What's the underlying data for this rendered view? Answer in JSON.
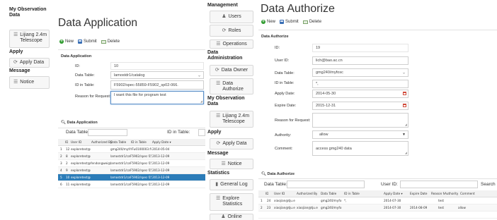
{
  "left": {
    "sidebar": {
      "section_my_obs": "My Observation Data",
      "telescope": "Lijiang 2.4m Telescope",
      "section_apply": "Apply",
      "apply_data": "Apply Data",
      "section_message": "Message",
      "notice": "Notice"
    },
    "title": "Data Application",
    "toolbar": {
      "new": "New",
      "submit": "Submit",
      "delete": "Delete"
    },
    "form": {
      "panel_title": "Data Application",
      "id_label": "ID:",
      "id_value": "10",
      "table_label": "Data Table:",
      "table_value": "lamostdr1/catalog",
      "idtable_label": "ID in Table:",
      "idtable_value": "F5902/spec-55859-F5902_sp02-066.",
      "reason_label": "Reason for Request:",
      "reason_value": "I want this file for program test"
    },
    "grid": {
      "panel_title": "Data Application",
      "filter_table_label": "Data Table:",
      "filter_id_label": "ID in Table:",
      "columns": [
        "ID",
        "User ID",
        "Authorized By",
        "Data Table",
        "ID in Table",
        "Apply Date ▾"
      ],
      "rows": [
        [
          "1",
          "12",
          "exploretest@e",
          "",
          "gmg240/myfo",
          "YFu0100003.fit",
          "2014-05-04"
        ],
        [
          "2",
          "8",
          "exploretest@e",
          "",
          "lamostdr1/cat",
          "F5902/spec-55",
          "2013-12-09"
        ],
        [
          "3",
          "2",
          "exploretest@e",
          "fendongwei@t",
          "lamostdr1/cat",
          "F5902/spec-55",
          "2013-12-09"
        ],
        [
          "4",
          "9",
          "exploretest@e",
          "",
          "lamostdr1/cat",
          "F5902/spec-55",
          "2013-12-09"
        ],
        [
          "5",
          "10",
          "exploretest@e",
          "",
          "lamostdr1/cat",
          "F5902/spec-55",
          "2013-12-09"
        ],
        [
          "6",
          "11",
          "exploretest@e",
          "",
          "lamostdr1/cat",
          "F5902/spec-55",
          "2013-12-09"
        ]
      ]
    }
  },
  "right": {
    "sidebar": {
      "section_management": "Management",
      "users": "Users",
      "roles": "Roles",
      "operations": "Operations",
      "section_data_admin": "Data Administration",
      "data_owner": "Data Owner",
      "data_authorize": "Data Authorize",
      "section_my_obs": "My Observation Data",
      "telescope": "Lijiang 2.4m Telescope",
      "section_apply": "Apply",
      "apply_data": "Apply Data",
      "section_message": "Message",
      "notice": "Notice",
      "section_statistics": "Statistics",
      "general_log": "General Log",
      "explore_statistics": "Explore Statistics",
      "online": "Online"
    },
    "title": "Data Authorize",
    "toolbar": {
      "new": "New",
      "submit": "Submit",
      "delete": "Delete"
    },
    "form": {
      "panel_title": "Data Authorize",
      "id_label": "ID:",
      "id_value": "19",
      "user_label": "User ID:",
      "user_value": "lich@bao.ac.cn",
      "table_label": "Data Table:",
      "table_value": "gmg240/myfosc",
      "idtable_label": "ID in Table:",
      "idtable_value": "*,",
      "apply_label": "Apply Date:",
      "apply_value": "2014-05-30",
      "expire_label": "Expire Date:",
      "expire_value": "2015-12-31",
      "reason_label": "Reason for Request:",
      "reason_value": "",
      "authority_label": "Authority:",
      "authority_value": "allow",
      "comment_label": "Comment:",
      "comment_value": "access gmg240 data"
    },
    "grid": {
      "panel_title": "Data Authorize",
      "filter_table_label": "Data Table:",
      "filter_user_label": "User ID:",
      "search_label": "Search",
      "columns": [
        "ID",
        "User ID",
        "Authorized By",
        "Data Table",
        "ID in Table",
        "Apply Date ▾",
        "Expire Date",
        "Reason fo",
        "Authority",
        "Comment"
      ],
      "rows": [
        [
          "1",
          "24",
          "xiaojian@tju.e",
          "",
          "gmg240/myfo",
          "*,",
          "2014-07-30",
          "",
          "test",
          "",
          ""
        ],
        [
          "2",
          "23",
          "xiaojian@tju.e",
          "xiaojian@tju.e",
          "gmg240/myfo",
          "",
          "2014-07-30",
          "2014-08-09",
          "test",
          "allow",
          ""
        ]
      ]
    }
  }
}
